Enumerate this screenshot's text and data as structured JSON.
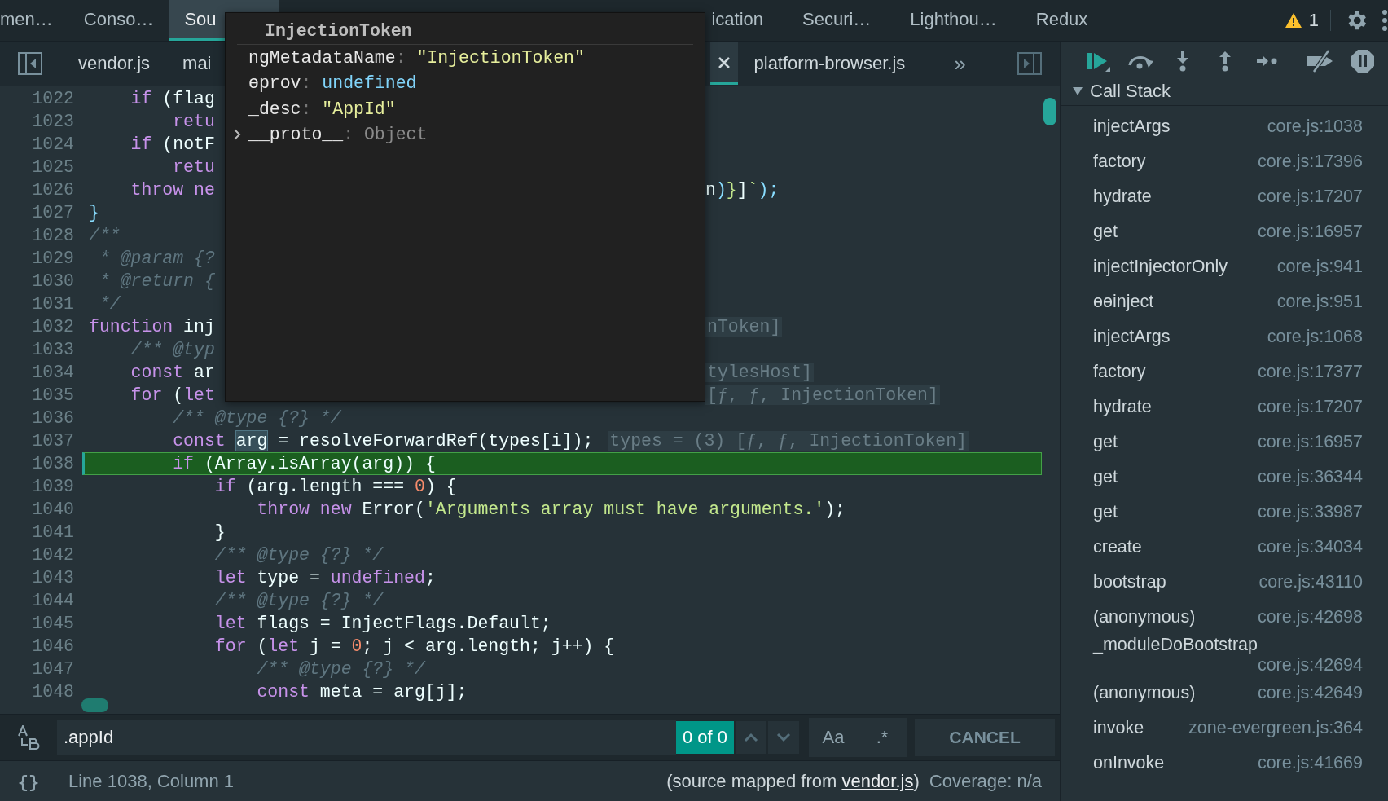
{
  "panel_tabs": {
    "before_popup": [
      {
        "label": "men…",
        "selected": false
      },
      {
        "label": "Conso…",
        "selected": false
      },
      {
        "label": "Sou",
        "selected": true
      }
    ],
    "after_popup": [
      {
        "label": "ication",
        "selected": false
      },
      {
        "label": "Securi…",
        "selected": false
      },
      {
        "label": "Lighthou…",
        "selected": false
      },
      {
        "label": "Redux",
        "selected": false
      }
    ],
    "warning_count": "1"
  },
  "file_tabs": {
    "before_popup": [
      {
        "label": "vendor.js",
        "selected": false
      },
      {
        "label": "mai",
        "selected": false
      }
    ],
    "after_popup": [
      {
        "label": "platform-browser.js",
        "selected": false
      }
    ],
    "more": "»"
  },
  "code_lines": [
    {
      "number": "1022",
      "current": false,
      "code": [
        {
          "kind": "keyword",
          "text": "    if"
        },
        {
          "kind": "plain",
          "text": " (flag"
        }
      ]
    },
    {
      "number": "1023",
      "current": false,
      "code": [
        {
          "kind": "keyword",
          "text": "        retu"
        }
      ]
    },
    {
      "number": "1024",
      "current": false,
      "code": [
        {
          "kind": "keyword",
          "text": "    if"
        },
        {
          "kind": "plain",
          "text": " (notF"
        }
      ]
    },
    {
      "number": "1025",
      "current": false,
      "code": [
        {
          "kind": "keyword",
          "text": "        retu"
        }
      ]
    },
    {
      "number": "1026",
      "current": false,
      "code": [
        {
          "kind": "keyword",
          "text": "    throw ne"
        }
      ],
      "after_popup": [
        {
          "kind": "plain",
          "text": "n"
        },
        {
          "kind": "punct",
          "text": ")"
        },
        {
          "kind": "string",
          "text": "}"
        },
        {
          "kind": "plain",
          "text": "]"
        },
        {
          "kind": "string",
          "text": "`"
        },
        {
          "kind": "punct",
          "text": ");"
        }
      ]
    },
    {
      "number": "1027",
      "current": false,
      "code": [
        {
          "kind": "punct",
          "text": "}"
        }
      ]
    },
    {
      "number": "1028",
      "current": false,
      "code": [
        {
          "kind": "comment",
          "text": "/**"
        }
      ]
    },
    {
      "number": "1029",
      "current": false,
      "code": [
        {
          "kind": "comment",
          "text": " * @param {?"
        }
      ]
    },
    {
      "number": "1030",
      "current": false,
      "code": [
        {
          "kind": "comment",
          "text": " * @return {"
        }
      ]
    },
    {
      "number": "1031",
      "current": false,
      "code": [
        {
          "kind": "comment",
          "text": " */"
        }
      ]
    },
    {
      "number": "1032",
      "current": false,
      "code": [
        {
          "kind": "keyword",
          "text": "function"
        },
        {
          "kind": "plain",
          "text": " inj"
        }
      ],
      "after_popup_hint": "nToken]"
    },
    {
      "number": "1033",
      "current": false,
      "code": [
        {
          "kind": "comment",
          "text": "    /** @typ"
        }
      ]
    },
    {
      "number": "1034",
      "current": false,
      "code": [
        {
          "kind": "keyword",
          "text": "    const"
        },
        {
          "kind": "plain",
          "text": " ar"
        }
      ],
      "after_popup_hint": "tylesHost]"
    },
    {
      "number": "1035",
      "current": false,
      "code": [
        {
          "kind": "keyword",
          "text": "    for"
        },
        {
          "kind": "plain",
          "text": " ("
        },
        {
          "kind": "keyword",
          "text": "let"
        }
      ],
      "after_popup_hint": "[ƒ, ƒ, InjectionToken]"
    },
    {
      "number": "1036",
      "current": false,
      "code": [
        {
          "kind": "comment",
          "text": "        /** @type {?} */"
        }
      ]
    },
    {
      "number": "1037",
      "current": false,
      "code": [
        {
          "kind": "keyword",
          "text": "        const "
        },
        {
          "kind": "selection",
          "text": "arg"
        },
        {
          "kind": "plain",
          "text": " = resolveForwardRef(types[i]);"
        }
      ],
      "hint": "types = (3) [ƒ, ƒ, InjectionToken]"
    },
    {
      "number": "1038",
      "current": true,
      "code": [
        {
          "kind": "keyword",
          "text": "        if"
        },
        {
          "kind": "plain",
          "text": " (Array.isArray(arg)) {"
        }
      ]
    },
    {
      "number": "1039",
      "current": false,
      "code": [
        {
          "kind": "keyword",
          "text": "            if"
        },
        {
          "kind": "plain",
          "text": " (arg.length === "
        },
        {
          "kind": "number",
          "text": "0"
        },
        {
          "kind": "plain",
          "text": ") {"
        }
      ]
    },
    {
      "number": "1040",
      "current": false,
      "code": [
        {
          "kind": "keyword",
          "text": "                throw new"
        },
        {
          "kind": "plain",
          "text": " Error("
        },
        {
          "kind": "string",
          "text": "'Arguments array must have arguments.'"
        },
        {
          "kind": "plain",
          "text": ");"
        }
      ]
    },
    {
      "number": "1041",
      "current": false,
      "code": [
        {
          "kind": "plain",
          "text": "            }"
        }
      ]
    },
    {
      "number": "1042",
      "current": false,
      "code": [
        {
          "kind": "comment",
          "text": "            /** @type {?} */"
        }
      ]
    },
    {
      "number": "1043",
      "current": false,
      "code": [
        {
          "kind": "keyword",
          "text": "            let"
        },
        {
          "kind": "plain",
          "text": " type = "
        },
        {
          "kind": "keyword",
          "text": "undefined"
        },
        {
          "kind": "plain",
          "text": ";"
        }
      ]
    },
    {
      "number": "1044",
      "current": false,
      "code": [
        {
          "kind": "comment",
          "text": "            /** @type {?} */"
        }
      ]
    },
    {
      "number": "1045",
      "current": false,
      "code": [
        {
          "kind": "keyword",
          "text": "            let"
        },
        {
          "kind": "plain",
          "text": " flags = InjectFlags.Default;"
        }
      ]
    },
    {
      "number": "1046",
      "current": false,
      "code": [
        {
          "kind": "keyword",
          "text": "            for"
        },
        {
          "kind": "plain",
          "text": " ("
        },
        {
          "kind": "keyword",
          "text": "let"
        },
        {
          "kind": "plain",
          "text": " j = "
        },
        {
          "kind": "number",
          "text": "0"
        },
        {
          "kind": "plain",
          "text": "; j < arg.length; j++) {"
        }
      ]
    },
    {
      "number": "1047",
      "current": false,
      "code": [
        {
          "kind": "comment",
          "text": "                /** @type {?} */"
        }
      ]
    },
    {
      "number": "1048",
      "current": false,
      "code": [
        {
          "kind": "keyword",
          "text": "                const"
        },
        {
          "kind": "plain",
          "text": " meta = arg[j];"
        }
      ]
    }
  ],
  "popup": {
    "title": "InjectionToken",
    "separator": ":",
    "properties": [
      {
        "key": "ngMetadataName",
        "value": "\"InjectionToken\"",
        "kind": "string"
      },
      {
        "key": "ɵprov",
        "value": "undefined",
        "kind": "undefined"
      },
      {
        "key": "_desc",
        "value": "\"AppId\"",
        "kind": "string"
      },
      {
        "key": "__proto__",
        "value": "Object",
        "kind": "object",
        "expanded": false
      }
    ]
  },
  "search_bar": {
    "value": ".appId",
    "match_count": "0 of 0",
    "case_button": "Aa",
    "regex_button": ".*",
    "cancel_button": "CANCEL"
  },
  "status_bar": {
    "format_button": "{}",
    "position": "Line 1038, Column 1",
    "source_prefix": "(source mapped from ",
    "source_link": "vendor.js",
    "source_suffix": ")",
    "coverage": "Coverage: n/a"
  },
  "call_stack": {
    "title": "Call Stack",
    "expanded": true,
    "frames": [
      {
        "name": "injectArgs",
        "location": "core.js:1038"
      },
      {
        "name": "factory",
        "location": "core.js:17396"
      },
      {
        "name": "hydrate",
        "location": "core.js:17207"
      },
      {
        "name": "get",
        "location": "core.js:16957"
      },
      {
        "name": "injectInjectorOnly",
        "location": "core.js:941"
      },
      {
        "name": "ɵɵinject",
        "location": "core.js:951"
      },
      {
        "name": "injectArgs",
        "location": "core.js:1068"
      },
      {
        "name": "factory",
        "location": "core.js:17377"
      },
      {
        "name": "hydrate",
        "location": "core.js:17207"
      },
      {
        "name": "get",
        "location": "core.js:16957"
      },
      {
        "name": "get",
        "location": "core.js:36344"
      },
      {
        "name": "get",
        "location": "core.js:33987"
      },
      {
        "name": "create",
        "location": "core.js:34034"
      },
      {
        "name": "bootstrap",
        "location": "core.js:43110"
      },
      {
        "name": "(anonymous)",
        "location": "core.js:42698"
      },
      {
        "name": "_moduleDoBootstrap",
        "location": "core.js:42694"
      },
      {
        "name": "(anonymous)",
        "location": "core.js:42649"
      },
      {
        "name": "invoke",
        "location": "zone-evergreen.js:364"
      },
      {
        "name": "onInvoke",
        "location": "core.js:41669"
      }
    ]
  }
}
